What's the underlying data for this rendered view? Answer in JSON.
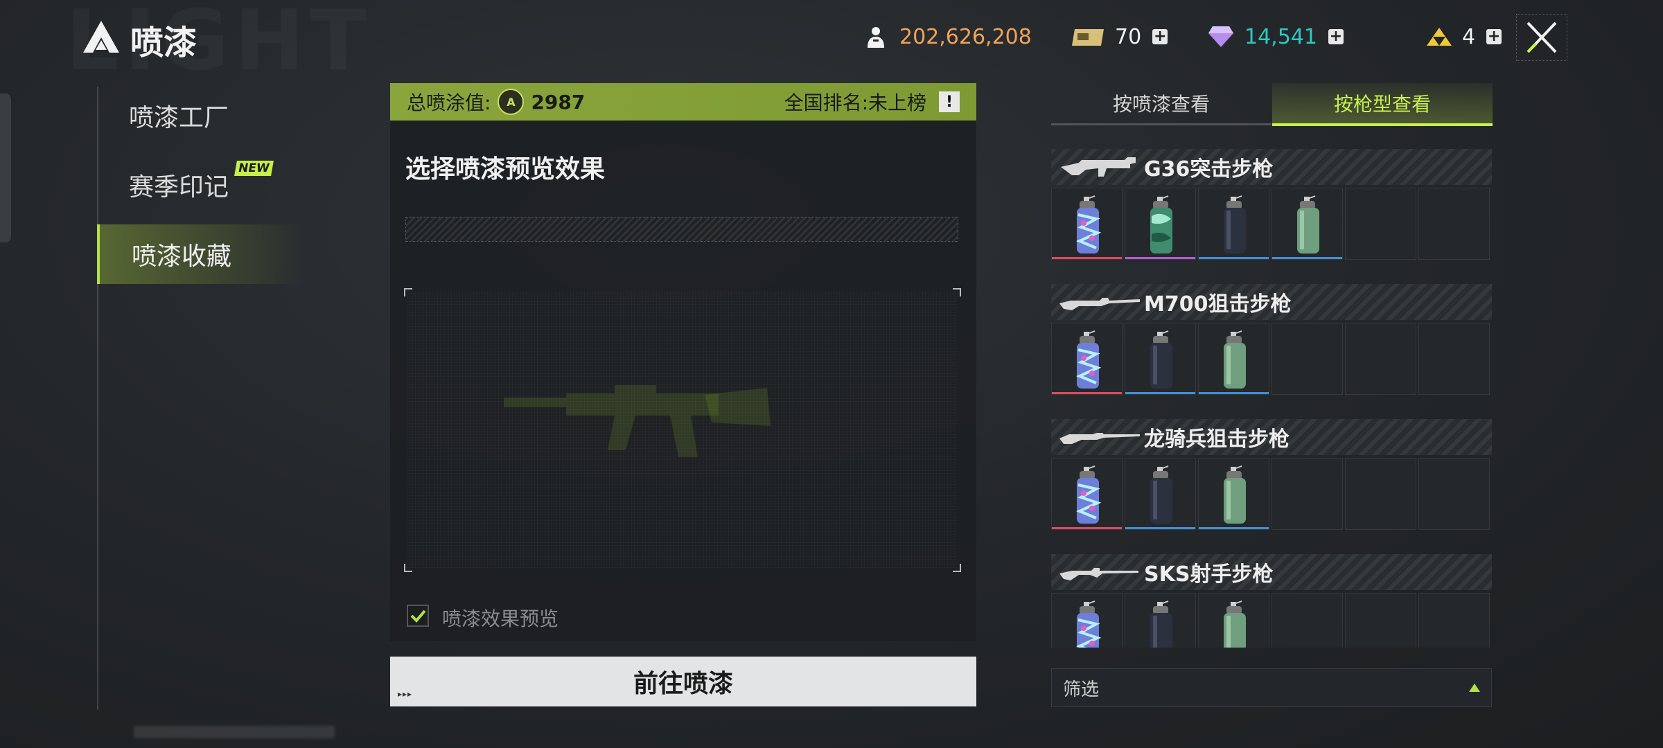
{
  "header": {
    "title": "喷漆",
    "bg_word": "LIGHT",
    "resources": {
      "gold": "202,626,208",
      "tickets": "70",
      "diamonds": "14,541",
      "rank_tokens": "4"
    }
  },
  "nav": {
    "items": [
      {
        "label": "喷漆工厂"
      },
      {
        "label": "赛季印记",
        "badge": "NEW"
      },
      {
        "label": "喷漆收藏"
      }
    ],
    "active_index": 2
  },
  "stats": {
    "total_label": "总喷涂值:",
    "total_value": "2987",
    "rank_label": "全国排名:未上榜",
    "info_icon": "!"
  },
  "preview": {
    "title": "选择喷漆预览效果",
    "checkbox_label": "喷漆效果预览",
    "checked": true
  },
  "go_button": {
    "label": "前往喷漆",
    "arrows": "▸▸▸"
  },
  "tabs": [
    {
      "label": "按喷漆查看"
    },
    {
      "label": "按枪型查看"
    }
  ],
  "weapons": [
    {
      "name": "G36突击步枪",
      "cans": [
        {
          "style": "graffiti",
          "rarity": "#e0475f"
        },
        {
          "style": "camo",
          "rarity": "#b55ad8"
        },
        {
          "style": "dark",
          "rarity": "#3f8ed8"
        },
        {
          "style": "green",
          "rarity": "#3f8ed8"
        }
      ]
    },
    {
      "name": "M700狙击步枪",
      "cans": [
        {
          "style": "graffiti",
          "rarity": "#e0475f"
        },
        {
          "style": "dark",
          "rarity": "#3f8ed8"
        },
        {
          "style": "green",
          "rarity": "#3f8ed8"
        }
      ]
    },
    {
      "name": "龙骑兵狙击步枪",
      "cans": [
        {
          "style": "graffiti",
          "rarity": "#e0475f"
        },
        {
          "style": "dark",
          "rarity": "#3f8ed8"
        },
        {
          "style": "green",
          "rarity": "#3f8ed8"
        }
      ]
    },
    {
      "name": "SKS射手步枪",
      "cans": [
        {
          "style": "graffiti",
          "rarity": "#e0475f"
        },
        {
          "style": "dark",
          "rarity": "#3f8ed8"
        },
        {
          "style": "green",
          "rarity": "#3f8ed8"
        }
      ]
    }
  ],
  "slots_per_row": 6,
  "filter": {
    "label": "筛选"
  },
  "colors": {
    "accent": "#c8f04e",
    "gold_text": "#f0a35a",
    "diamond_text": "#2ec9c3"
  }
}
